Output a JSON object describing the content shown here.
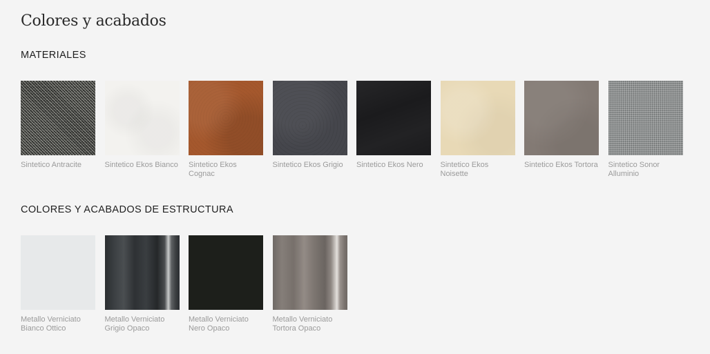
{
  "page": {
    "title": "Colores y acabados"
  },
  "materials": {
    "heading": "MATERIALES",
    "items": [
      {
        "label": "Sintetico Antracite",
        "texture": "antracite",
        "color": "#3c3d3a"
      },
      {
        "label": "Sintetico Ekos Bianco",
        "texture": "bianco",
        "color": "#f3f2ef"
      },
      {
        "label": "Sintetico Ekos Cognac",
        "texture": "cognac",
        "color": "#a5582d"
      },
      {
        "label": "Sintetico Ekos Grigio",
        "texture": "grigio",
        "color": "#45464c"
      },
      {
        "label": "Sintetico Ekos Nero",
        "texture": "nero",
        "color": "#1b1b1d"
      },
      {
        "label": "Sintetico Ekos Noisette",
        "texture": "noisette",
        "color": "#e8d9b6"
      },
      {
        "label": "Sintetico Ekos Tortora",
        "texture": "tortora",
        "color": "#837a74"
      },
      {
        "label": "Sintetico Sonor Alluminio",
        "texture": "alluminio",
        "color": "#8f9292"
      }
    ]
  },
  "structure": {
    "heading": "COLORES Y ACABADOS DE ESTRUCTURA",
    "items": [
      {
        "label": "Metallo Verniciato Bianco Ottico",
        "finish": "bianco",
        "color": "#e7e9ea"
      },
      {
        "label": "Metallo Verniciato Grigio Opaco",
        "finish": "grigio",
        "color": "#3b3f42"
      },
      {
        "label": "Metallo Verniciato Nero Opaco",
        "finish": "nero",
        "color": "#1d1f1b"
      },
      {
        "label": "Metallo Verniciato Tortora Opaco",
        "finish": "tortora",
        "color": "#857e79"
      }
    ]
  }
}
